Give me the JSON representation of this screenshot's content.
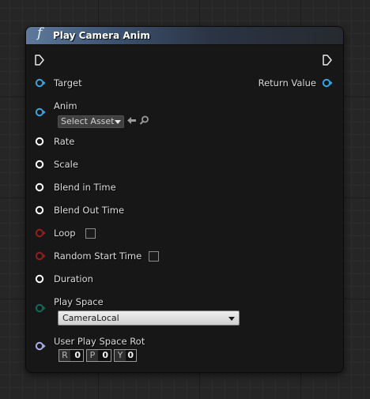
{
  "node": {
    "title": "Play Camera Anim",
    "function_icon": "f",
    "header_color": "#3c5270"
  },
  "pins": {
    "exec_in": {
      "icon": "exec-in-icon"
    },
    "exec_out": {
      "icon": "exec-out-icon"
    },
    "target": {
      "label": "Target",
      "color": "#3aa3e0"
    },
    "return_value": {
      "label": "Return Value",
      "color": "#3aa3e0"
    },
    "anim": {
      "label": "Anim",
      "color": "#3aa3e0",
      "asset_picker_label": "Select Asset"
    },
    "rate": {
      "label": "Rate",
      "color": "#ffffff"
    },
    "scale": {
      "label": "Scale",
      "color": "#ffffff"
    },
    "blend_in": {
      "label": "Blend in Time",
      "color": "#ffffff"
    },
    "blend_out": {
      "label": "Blend Out Time",
      "color": "#ffffff"
    },
    "loop": {
      "label": "Loop",
      "color": "#9a1b1b",
      "checked": false
    },
    "random_start": {
      "label": "Random Start Time",
      "color": "#9a1b1b",
      "checked": false
    },
    "duration": {
      "label": "Duration",
      "color": "#ffffff"
    },
    "play_space": {
      "label": "Play Space",
      "color": "#0e6b58",
      "value": "CameraLocal"
    },
    "user_rot": {
      "label": "User Play Space Rot",
      "color": "#a7b1f0",
      "r_key": "R",
      "r_value": "0",
      "p_key": "P",
      "p_value": "0",
      "y_key": "Y",
      "y_value": "0"
    }
  }
}
